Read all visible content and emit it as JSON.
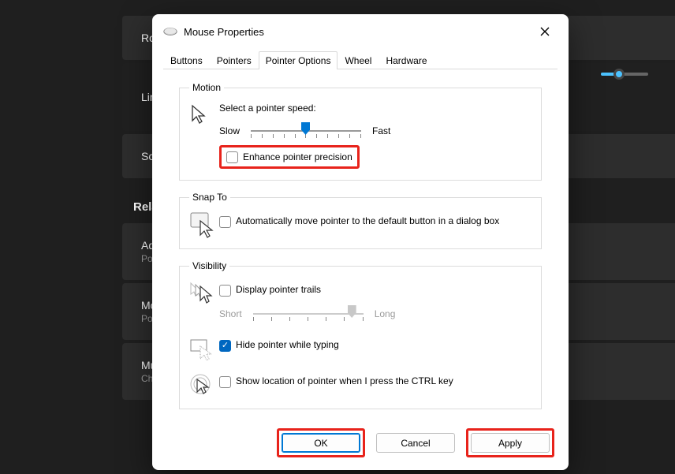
{
  "bg": {
    "row1": "Rol",
    "row2": "Line",
    "row3": "Scro",
    "relatedHeading": "Relate",
    "adv": {
      "title": "Ad",
      "sub": "Poin"
    },
    "mouse": {
      "title": "Mo",
      "sub": "Poin"
    },
    "multi": {
      "title": "Mu",
      "sub": "Change how cursor moves over display boundaries"
    }
  },
  "dialog": {
    "title": "Mouse Properties",
    "tabs": {
      "buttons": "Buttons",
      "pointers": "Pointers",
      "pointerOptions": "Pointer Options",
      "wheel": "Wheel",
      "hardware": "Hardware"
    },
    "motion": {
      "legend": "Motion",
      "speedLabel": "Select a pointer speed:",
      "slow": "Slow",
      "fast": "Fast",
      "enhance": "Enhance pointer precision"
    },
    "snap": {
      "legend": "Snap To",
      "text": "Automatically move pointer to the default button in a dialog box"
    },
    "visibility": {
      "legend": "Visibility",
      "trails": "Display pointer trails",
      "short": "Short",
      "long": "Long",
      "hide": "Hide pointer while typing",
      "ctrl": "Show location of pointer when I press the CTRL key"
    },
    "buttons": {
      "ok": "OK",
      "cancel": "Cancel",
      "apply": "Apply"
    }
  }
}
